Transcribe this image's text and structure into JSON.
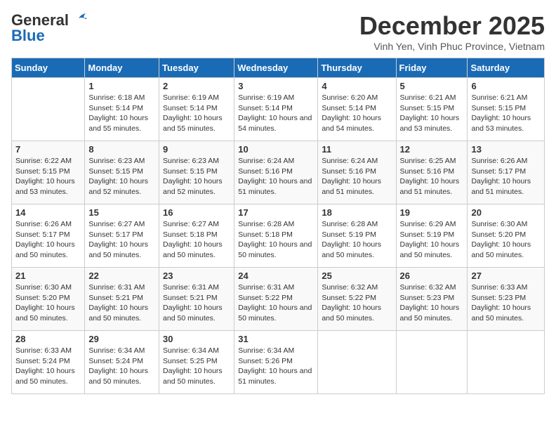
{
  "logo": {
    "line1": "General",
    "line2": "Blue"
  },
  "title": "December 2025",
  "subtitle": "Vinh Yen, Vinh Phuc Province, Vietnam",
  "days_header": [
    "Sunday",
    "Monday",
    "Tuesday",
    "Wednesday",
    "Thursday",
    "Friday",
    "Saturday"
  ],
  "weeks": [
    [
      {
        "day": "",
        "sunrise": "",
        "sunset": "",
        "daylight": ""
      },
      {
        "day": "1",
        "sunrise": "Sunrise: 6:18 AM",
        "sunset": "Sunset: 5:14 PM",
        "daylight": "Daylight: 10 hours and 55 minutes."
      },
      {
        "day": "2",
        "sunrise": "Sunrise: 6:19 AM",
        "sunset": "Sunset: 5:14 PM",
        "daylight": "Daylight: 10 hours and 55 minutes."
      },
      {
        "day": "3",
        "sunrise": "Sunrise: 6:19 AM",
        "sunset": "Sunset: 5:14 PM",
        "daylight": "Daylight: 10 hours and 54 minutes."
      },
      {
        "day": "4",
        "sunrise": "Sunrise: 6:20 AM",
        "sunset": "Sunset: 5:14 PM",
        "daylight": "Daylight: 10 hours and 54 minutes."
      },
      {
        "day": "5",
        "sunrise": "Sunrise: 6:21 AM",
        "sunset": "Sunset: 5:15 PM",
        "daylight": "Daylight: 10 hours and 53 minutes."
      },
      {
        "day": "6",
        "sunrise": "Sunrise: 6:21 AM",
        "sunset": "Sunset: 5:15 PM",
        "daylight": "Daylight: 10 hours and 53 minutes."
      }
    ],
    [
      {
        "day": "7",
        "sunrise": "Sunrise: 6:22 AM",
        "sunset": "Sunset: 5:15 PM",
        "daylight": "Daylight: 10 hours and 53 minutes."
      },
      {
        "day": "8",
        "sunrise": "Sunrise: 6:23 AM",
        "sunset": "Sunset: 5:15 PM",
        "daylight": "Daylight: 10 hours and 52 minutes."
      },
      {
        "day": "9",
        "sunrise": "Sunrise: 6:23 AM",
        "sunset": "Sunset: 5:15 PM",
        "daylight": "Daylight: 10 hours and 52 minutes."
      },
      {
        "day": "10",
        "sunrise": "Sunrise: 6:24 AM",
        "sunset": "Sunset: 5:16 PM",
        "daylight": "Daylight: 10 hours and 51 minutes."
      },
      {
        "day": "11",
        "sunrise": "Sunrise: 6:24 AM",
        "sunset": "Sunset: 5:16 PM",
        "daylight": "Daylight: 10 hours and 51 minutes."
      },
      {
        "day": "12",
        "sunrise": "Sunrise: 6:25 AM",
        "sunset": "Sunset: 5:16 PM",
        "daylight": "Daylight: 10 hours and 51 minutes."
      },
      {
        "day": "13",
        "sunrise": "Sunrise: 6:26 AM",
        "sunset": "Sunset: 5:17 PM",
        "daylight": "Daylight: 10 hours and 51 minutes."
      }
    ],
    [
      {
        "day": "14",
        "sunrise": "Sunrise: 6:26 AM",
        "sunset": "Sunset: 5:17 PM",
        "daylight": "Daylight: 10 hours and 50 minutes."
      },
      {
        "day": "15",
        "sunrise": "Sunrise: 6:27 AM",
        "sunset": "Sunset: 5:17 PM",
        "daylight": "Daylight: 10 hours and 50 minutes."
      },
      {
        "day": "16",
        "sunrise": "Sunrise: 6:27 AM",
        "sunset": "Sunset: 5:18 PM",
        "daylight": "Daylight: 10 hours and 50 minutes."
      },
      {
        "day": "17",
        "sunrise": "Sunrise: 6:28 AM",
        "sunset": "Sunset: 5:18 PM",
        "daylight": "Daylight: 10 hours and 50 minutes."
      },
      {
        "day": "18",
        "sunrise": "Sunrise: 6:28 AM",
        "sunset": "Sunset: 5:19 PM",
        "daylight": "Daylight: 10 hours and 50 minutes."
      },
      {
        "day": "19",
        "sunrise": "Sunrise: 6:29 AM",
        "sunset": "Sunset: 5:19 PM",
        "daylight": "Daylight: 10 hours and 50 minutes."
      },
      {
        "day": "20",
        "sunrise": "Sunrise: 6:30 AM",
        "sunset": "Sunset: 5:20 PM",
        "daylight": "Daylight: 10 hours and 50 minutes."
      }
    ],
    [
      {
        "day": "21",
        "sunrise": "Sunrise: 6:30 AM",
        "sunset": "Sunset: 5:20 PM",
        "daylight": "Daylight: 10 hours and 50 minutes."
      },
      {
        "day": "22",
        "sunrise": "Sunrise: 6:31 AM",
        "sunset": "Sunset: 5:21 PM",
        "daylight": "Daylight: 10 hours and 50 minutes."
      },
      {
        "day": "23",
        "sunrise": "Sunrise: 6:31 AM",
        "sunset": "Sunset: 5:21 PM",
        "daylight": "Daylight: 10 hours and 50 minutes."
      },
      {
        "day": "24",
        "sunrise": "Sunrise: 6:31 AM",
        "sunset": "Sunset: 5:22 PM",
        "daylight": "Daylight: 10 hours and 50 minutes."
      },
      {
        "day": "25",
        "sunrise": "Sunrise: 6:32 AM",
        "sunset": "Sunset: 5:22 PM",
        "daylight": "Daylight: 10 hours and 50 minutes."
      },
      {
        "day": "26",
        "sunrise": "Sunrise: 6:32 AM",
        "sunset": "Sunset: 5:23 PM",
        "daylight": "Daylight: 10 hours and 50 minutes."
      },
      {
        "day": "27",
        "sunrise": "Sunrise: 6:33 AM",
        "sunset": "Sunset: 5:23 PM",
        "daylight": "Daylight: 10 hours and 50 minutes."
      }
    ],
    [
      {
        "day": "28",
        "sunrise": "Sunrise: 6:33 AM",
        "sunset": "Sunset: 5:24 PM",
        "daylight": "Daylight: 10 hours and 50 minutes."
      },
      {
        "day": "29",
        "sunrise": "Sunrise: 6:34 AM",
        "sunset": "Sunset: 5:24 PM",
        "daylight": "Daylight: 10 hours and 50 minutes."
      },
      {
        "day": "30",
        "sunrise": "Sunrise: 6:34 AM",
        "sunset": "Sunset: 5:25 PM",
        "daylight": "Daylight: 10 hours and 50 minutes."
      },
      {
        "day": "31",
        "sunrise": "Sunrise: 6:34 AM",
        "sunset": "Sunset: 5:26 PM",
        "daylight": "Daylight: 10 hours and 51 minutes."
      },
      {
        "day": "",
        "sunrise": "",
        "sunset": "",
        "daylight": ""
      },
      {
        "day": "",
        "sunrise": "",
        "sunset": "",
        "daylight": ""
      },
      {
        "day": "",
        "sunrise": "",
        "sunset": "",
        "daylight": ""
      }
    ]
  ]
}
